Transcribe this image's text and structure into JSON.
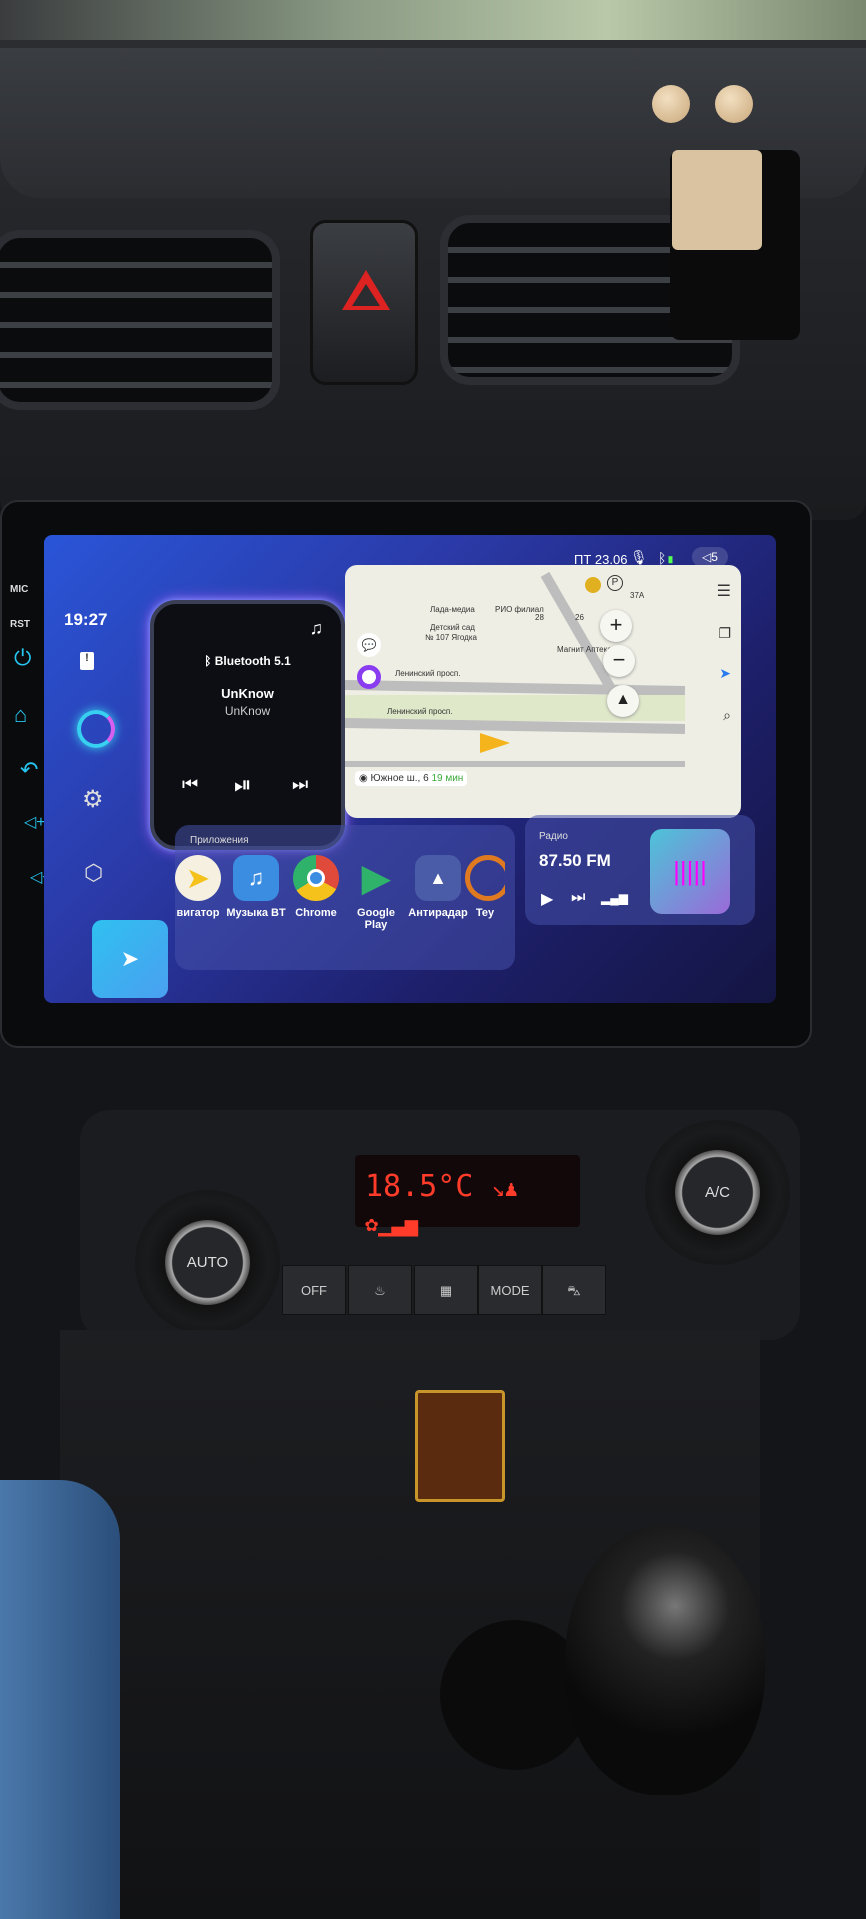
{
  "head_unit": {
    "bezel_labels": {
      "mic": "MIC",
      "rst": "RST"
    },
    "side_buttons": [
      "power-icon",
      "home-icon",
      "back-icon",
      "volume-up-icon",
      "volume-down-icon"
    ],
    "status_bar": {
      "date": "ПТ 23.06",
      "volume": "5",
      "icons": [
        "microphone-icon",
        "bluetooth-icon",
        "battery-icon",
        "speaker-icon"
      ]
    },
    "sidebar": {
      "time": "19:27",
      "icons": [
        "sd-card-icon",
        "assistant-ring-icon",
        "gear-icon",
        "cube-icon",
        "navigation-icon"
      ]
    },
    "bluetooth_card": {
      "title": "Bluetooth 5.1",
      "track": "UnKnow",
      "artist": "UnKnow"
    },
    "map": {
      "labels": [
        "Лада-медиа",
        "РИО филиал",
        "Детский сад",
        "№ 107 Ягодка",
        "Магнит Аптека",
        "Ленинский просп.",
        "Ленинский просп.",
        "28",
        "26",
        "37А"
      ],
      "route": {
        "destination": "Южное ш., 6",
        "eta": "19 мин",
        "eta_color": "#3caa3c"
      }
    },
    "apps": {
      "title": "Приложения",
      "items": [
        {
          "label": "вигатор",
          "color": "#f5c21b"
        },
        {
          "label": "Музыка BT",
          "color": "#3a8de0"
        },
        {
          "label": "Chrome",
          "color": "#e04a3a"
        },
        {
          "label": "Google Play",
          "color": "#2fb36a"
        },
        {
          "label": "Антирадар",
          "color": "#4a5ca8"
        },
        {
          "label": "Tey",
          "color": "#e07a20"
        }
      ]
    },
    "radio": {
      "title": "Радио",
      "frequency": "87.50 FM"
    }
  },
  "climate": {
    "display_temp": "18.5°C",
    "buttons": [
      "OFF",
      "defrost-front-icon",
      "defrost-rear-icon",
      "MODE",
      "recirculation-icon"
    ],
    "knob_left": "AUTO",
    "knob_right": "A/C"
  },
  "accent": "#27c6f0"
}
